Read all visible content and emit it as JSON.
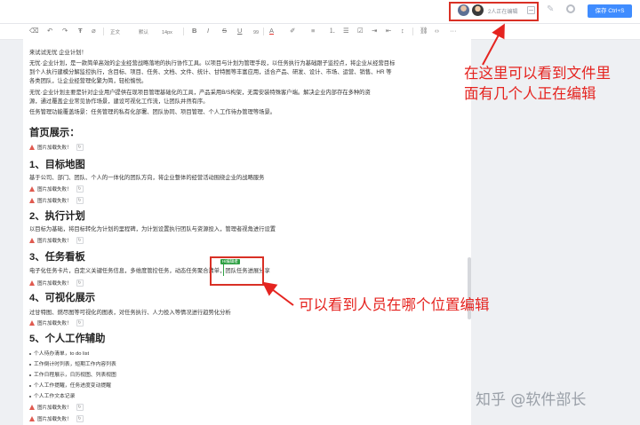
{
  "topbar": {
    "collab_status": "2人正在编辑",
    "save_label": "保存 Ctrl+S"
  },
  "toolbar": {
    "style_label": "正文",
    "font_label": "默认",
    "size_label": "14px",
    "bold": "B",
    "italic": "I",
    "strike": "S",
    "underline": "U",
    "quote": "99",
    "font_color": "A",
    "text_align": "≡",
    "list": "☰",
    "more": "···"
  },
  "doc": {
    "intro_title": "来试试无忧 企业计划！",
    "intro_p1": [
      "无忧·企业计划，是一款简单高效的企业经营战略落地的执行协作工具。以项目与计划为管理手段，以任务执行为基础跟子监控点，将企业从经营目标",
      "到个人执行建模分解监控执行，含目标、项目、任务、文档、文件、统计、甘特图等丰富应用，适合产品、研发、设计、市场、运营、销售、HR 等",
      "各类团队，让企业经营理化繁为简，轻松愉悦。"
    ],
    "intro_p2": [
      "无忧·企业计划主要是针对企业用户提供在现项目管理基础化的工具，产品采用B/S构架，无需安装特殊客户端。解决企业内部存在多种的资",
      "源，通过覆盖企业常见协作场景，建设可视化工作流，让团队井然有序。",
      "任务管理功能覆盖场景：任务管理的私有化部署、团队协同、项目管理、个人工作待办管理等场景。"
    ],
    "sections": [
      {
        "heading": "首页展示："
      },
      {
        "heading": "1、目标地图",
        "text": "基于公司、部门、团队、个人的一体化的团队方向，将企业整体的经营活动围绕企业的战略服务"
      },
      {
        "heading": "2、执行计划",
        "text": "以目标为基础，将目标转化为计划的里程碑，为计划设置执行团队与资源投入，管理者视角进行设置"
      },
      {
        "heading": "3、任务看板",
        "text": "电子化任务卡片，自定义关键任务信息，多维度管控任务，动态任务聚合清单，团队任务进展分享"
      },
      {
        "heading": "4、可视化展示",
        "text": "过甘特图、燃尽图等可视化的图表，对任务执行、人力投入等情况进行趋势化分析"
      },
      {
        "heading": "5、个人工作辅助"
      }
    ],
    "list_items": [
      "个人待办清单，to do list",
      "工作倒计时列表，短期工作内容列表",
      "工作日程展示，日历视图、列表视图",
      "个人工作提醒，任务进度变动提醒",
      "个人工作文本记录"
    ],
    "image_failed_label": "图片加载失败！",
    "reload_icon": "↻",
    "cursor_tag": "Hi编辑者"
  },
  "annotations": {
    "top": [
      "在这里可以看到文件里",
      "面有几个人正在编辑"
    ],
    "cursor": "可以看到人员在哪个位置编辑"
  },
  "watermark": "知乎 @软件部长",
  "colors": {
    "annotation_red": "#e52420",
    "save_blue": "#3f8cff",
    "cursor_green": "#2ea043"
  }
}
